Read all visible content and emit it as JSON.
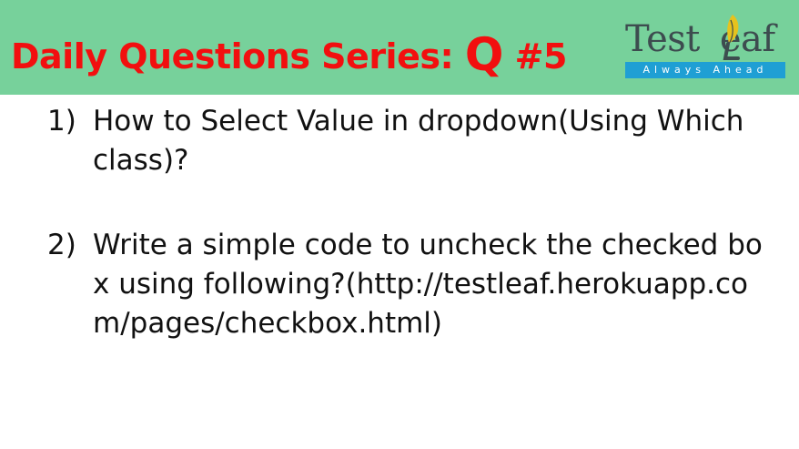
{
  "header": {
    "title_prefix": "Daily Questions Series: ",
    "title_q": "Q",
    "title_suffix": " #5",
    "banner_color": "#77d19b",
    "title_color": "#f20f0f"
  },
  "logo": {
    "name_left": "Test",
    "name_right": "eaf",
    "tagline": "Always Ahead",
    "bar_color": "#1f9fd4"
  },
  "questions": [
    {
      "number": "1)",
      "text": "How to Select Value in dropdown(Using Which class)?"
    },
    {
      "number": "2)",
      "text": "Write a simple code to uncheck the checked box using following?(http://testleaf.herokuapp.com/pages/checkbox.html)"
    }
  ]
}
